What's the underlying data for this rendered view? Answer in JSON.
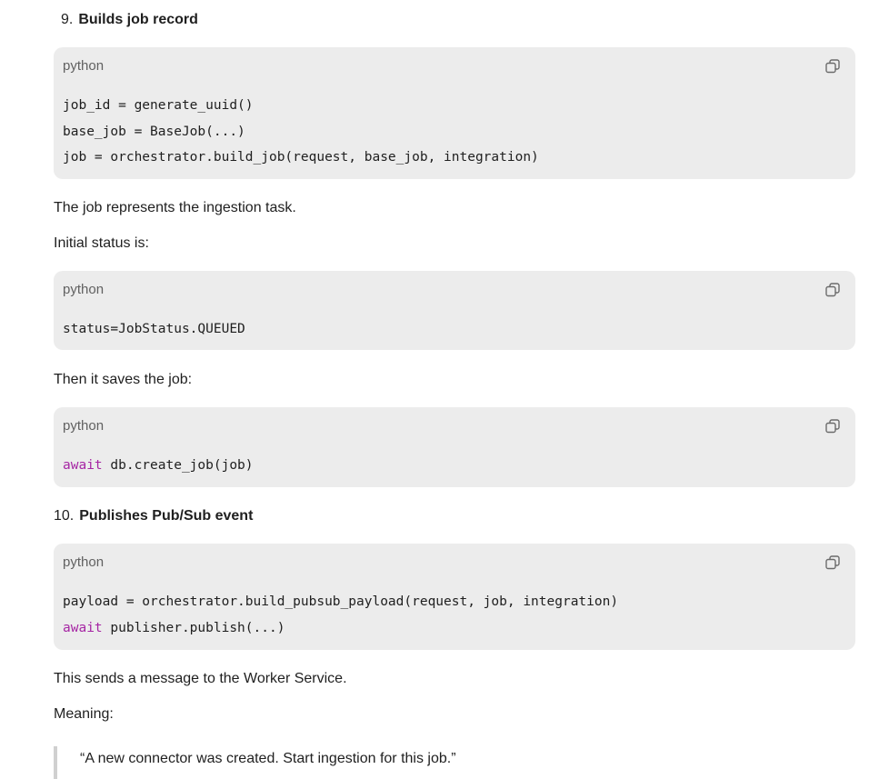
{
  "steps": [
    {
      "number": "9.",
      "title": "Builds job record"
    },
    {
      "number": "10.",
      "title": "Publishes Pub/Sub event"
    }
  ],
  "code_blocks": [
    {
      "lang": "python",
      "lines": [
        [
          {
            "t": "job_id = generate_uuid()"
          }
        ],
        [
          {
            "t": "base_job = BaseJob(...)"
          }
        ],
        [
          {
            "t": "job = orchestrator.build_job(request, base_job, integration)"
          }
        ]
      ]
    },
    {
      "lang": "python",
      "lines": [
        [
          {
            "t": "status=JobStatus.QUEUED"
          }
        ]
      ]
    },
    {
      "lang": "python",
      "lines": [
        [
          {
            "t": "await",
            "kw": true
          },
          {
            "t": " db.create_job(job)"
          }
        ]
      ]
    },
    {
      "lang": "python",
      "lines": [
        [
          {
            "t": "payload = orchestrator.build_pubsub_payload(request, job, integration)"
          }
        ],
        [
          {
            "t": "await",
            "kw": true
          },
          {
            "t": " publisher.publish(...)"
          }
        ]
      ]
    }
  ],
  "paragraphs": [
    "The job represents the ingestion task.",
    "Initial status is:",
    "Then it saves the job:",
    "This sends a message to the Worker Service.",
    "Meaning:"
  ],
  "quote": "“A new connector was created. Start ingestion for this job.”",
  "icons": {
    "copy": "copy-icon"
  },
  "colors": {
    "code_bg": "#ececec",
    "keyword": "#a626a4"
  }
}
